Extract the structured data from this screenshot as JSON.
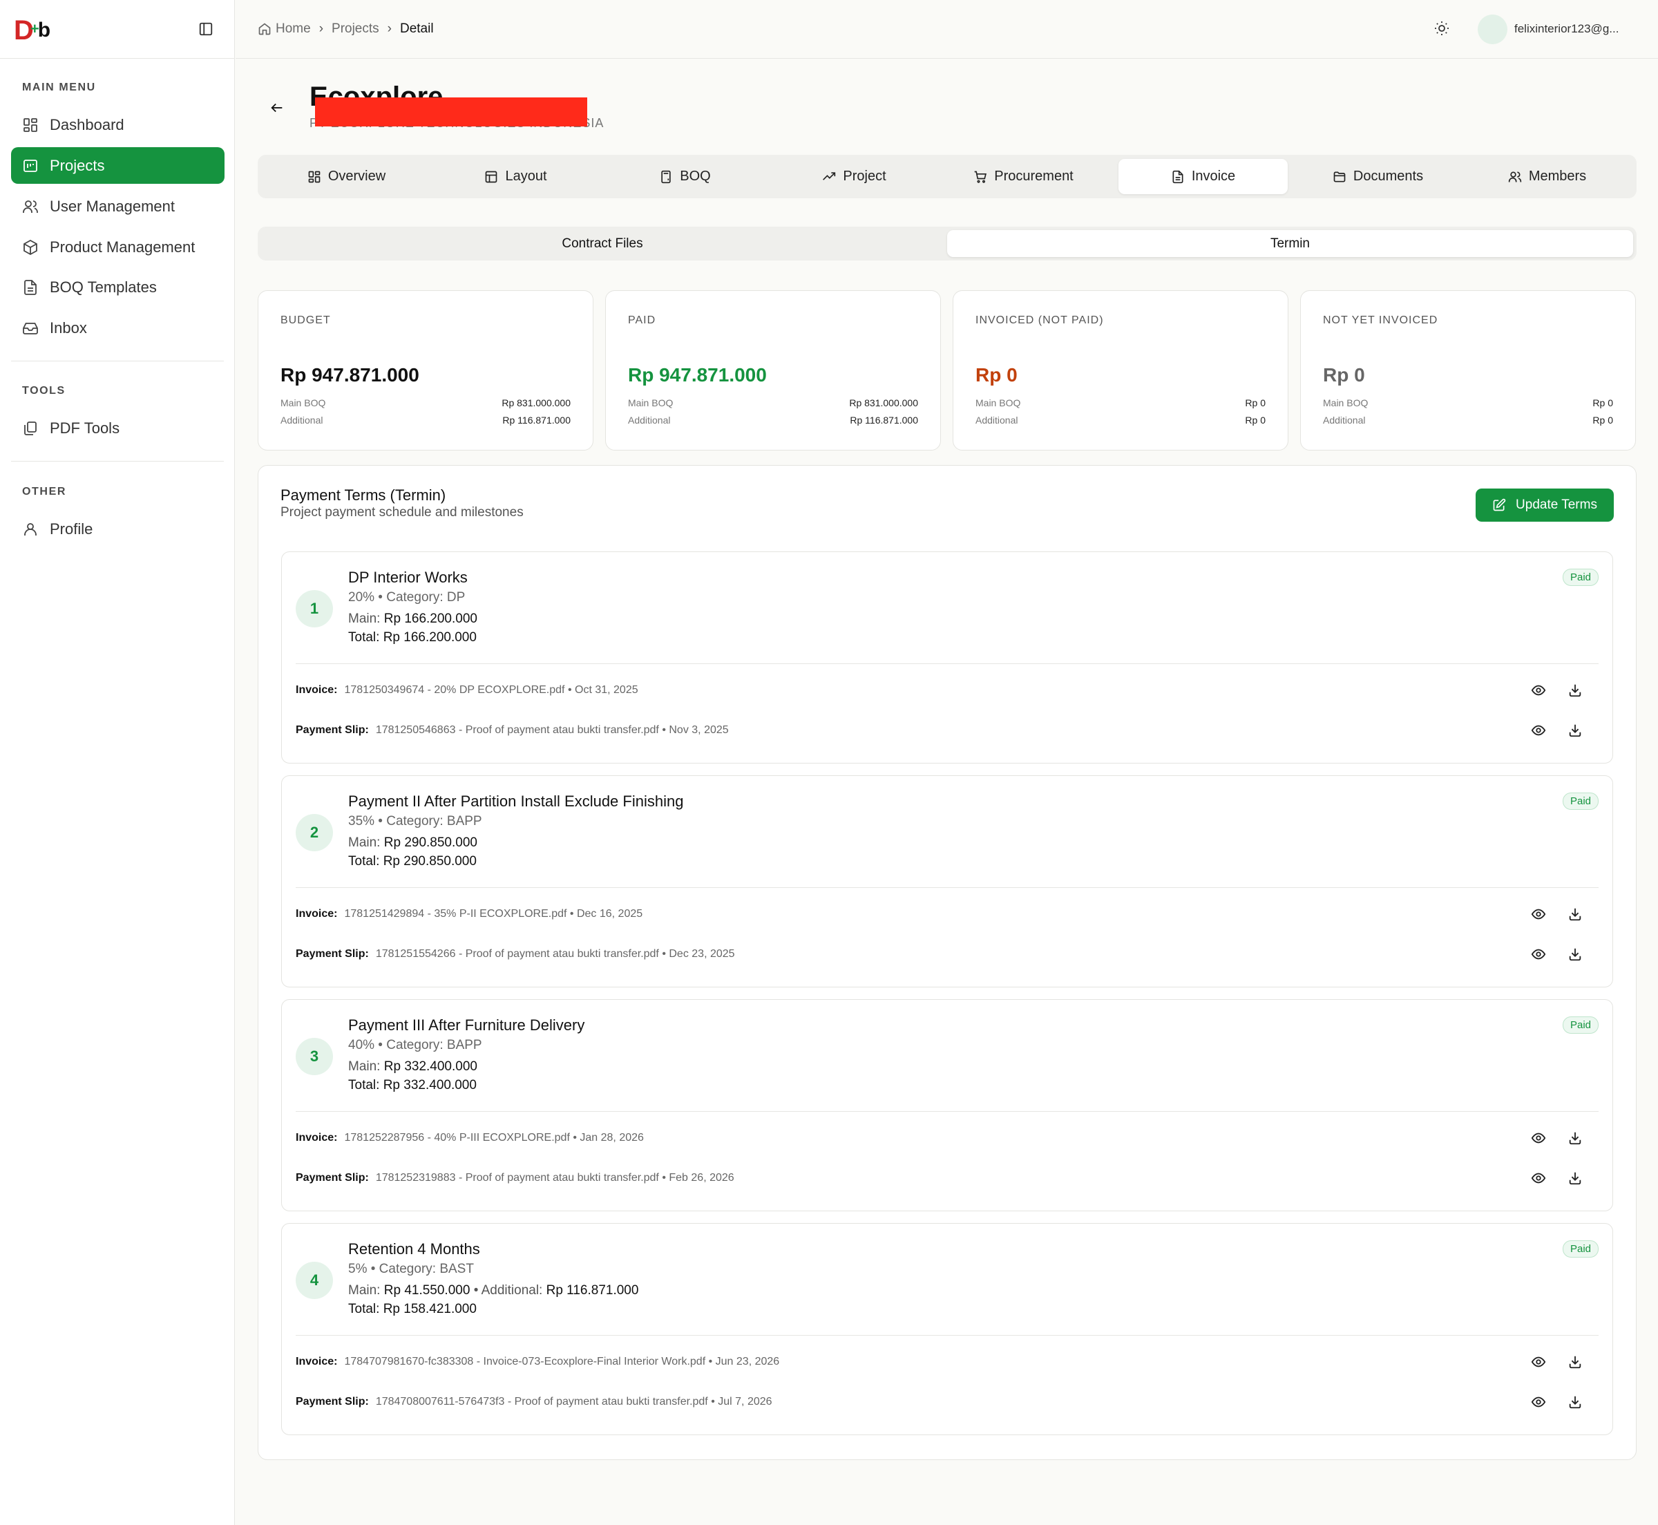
{
  "sidebar": {
    "sections": [
      {
        "label": "MAIN MENU",
        "items": [
          {
            "label": "Dashboard",
            "icon": "dashboard-icon"
          },
          {
            "label": "Projects",
            "icon": "projects-icon",
            "active": true
          },
          {
            "label": "User Management",
            "icon": "users-icon"
          },
          {
            "label": "Product Management",
            "icon": "box-icon"
          },
          {
            "label": "BOQ Templates",
            "icon": "file-icon"
          },
          {
            "label": "Inbox",
            "icon": "inbox-icon"
          }
        ]
      },
      {
        "label": "TOOLS",
        "items": [
          {
            "label": "PDF Tools",
            "icon": "copy-icon"
          }
        ]
      },
      {
        "label": "OTHER",
        "items": [
          {
            "label": "Profile",
            "icon": "user-icon"
          }
        ]
      }
    ]
  },
  "breadcrumb": {
    "home": "Home",
    "projects": "Projects",
    "current": "Detail"
  },
  "user": {
    "email": "felixinterior123@g..."
  },
  "project": {
    "name": "Ecoxplore",
    "subtitle": "PT ECOXPLORE TECHNOLOGIES INDONESIA"
  },
  "tabs": [
    {
      "label": "Overview",
      "icon": "grid-icon"
    },
    {
      "label": "Layout",
      "icon": "layout-icon"
    },
    {
      "label": "BOQ",
      "icon": "calculator-icon"
    },
    {
      "label": "Project",
      "icon": "trending-up-icon"
    },
    {
      "label": "Procurement",
      "icon": "cart-icon"
    },
    {
      "label": "Invoice",
      "icon": "document-icon",
      "active": true
    },
    {
      "label": "Documents",
      "icon": "folder-icon"
    },
    {
      "label": "Members",
      "icon": "members-icon"
    }
  ],
  "subtabs": [
    {
      "label": "Contract Files"
    },
    {
      "label": "Termin",
      "active": true
    }
  ],
  "cards": [
    {
      "label": "BUDGET",
      "amount": "Rp 947.871.000",
      "color": "#111111",
      "main_label": "Main BOQ",
      "main_value": "Rp 831.000.000",
      "add_label": "Additional",
      "add_value": "Rp 116.871.000"
    },
    {
      "label": "PAID",
      "amount": "Rp 947.871.000",
      "color": "#15933f",
      "main_label": "Main BOQ",
      "main_value": "Rp 831.000.000",
      "add_label": "Additional",
      "add_value": "Rp 116.871.000"
    },
    {
      "label": "INVOICED (NOT PAID)",
      "amount": "Rp 0",
      "color": "#c2410c",
      "main_label": "Main BOQ",
      "main_value": "Rp 0",
      "add_label": "Additional",
      "add_value": "Rp 0"
    },
    {
      "label": "NOT YET INVOICED",
      "amount": "Rp 0",
      "color": "#666666",
      "main_label": "Main BOQ",
      "main_value": "Rp 0",
      "add_label": "Additional",
      "add_value": "Rp 0"
    }
  ],
  "terms_section": {
    "title": "Payment Terms (Termin)",
    "subtitle": "Project payment schedule and milestones",
    "update_label": "Update Terms"
  },
  "labels": {
    "main": "Main:",
    "additional": "Additional:",
    "total": "Total:",
    "invoice": "Invoice:",
    "slip": "Payment Slip:"
  },
  "terms": [
    {
      "num": "1",
      "title": "DP Interior Works",
      "meta": "20% • Category: DP",
      "main": "Rp 166.200.000",
      "additional": "",
      "total": "Rp 166.200.000",
      "status": "Paid",
      "invoice_file": "1781250349674 - 20% DP ECOXPLORE.pdf",
      "invoice_date": "• Oct 31, 2025",
      "slip_file": "1781250546863 - Proof of payment atau bukti transfer.pdf",
      "slip_date": "• Nov 3, 2025"
    },
    {
      "num": "2",
      "title": "Payment II After Partition Install Exclude Finishing",
      "meta": "35% • Category: BAPP",
      "main": "Rp 290.850.000",
      "additional": "",
      "total": "Rp 290.850.000",
      "status": "Paid",
      "invoice_file": "1781251429894 - 35% P-II ECOXPLORE.pdf",
      "invoice_date": "• Dec 16, 2025",
      "slip_file": "1781251554266 - Proof of payment atau bukti transfer.pdf",
      "slip_date": "• Dec 23, 2025"
    },
    {
      "num": "3",
      "title": "Payment III After Furniture Delivery",
      "meta": "40% • Category: BAPP",
      "main": "Rp 332.400.000",
      "additional": "",
      "total": "Rp 332.400.000",
      "status": "Paid",
      "invoice_file": "1781252287956 - 40% P-III ECOXPLORE.pdf",
      "invoice_date": "• Jan 28, 2026",
      "slip_file": "1781252319883 - Proof of payment atau bukti transfer.pdf",
      "slip_date": "• Feb 26, 2026"
    },
    {
      "num": "4",
      "title": "Retention 4 Months",
      "meta": "5% • Category: BAST",
      "main": "Rp 41.550.000",
      "additional": "Rp 116.871.000",
      "total": "Rp 158.421.000",
      "status": "Paid",
      "invoice_file": "1784707981670-fc383308 - Invoice-073-Ecoxplore-Final Interior Work.pdf",
      "invoice_date": "• Jun 23, 2026",
      "slip_file": "1784708007611-576473f3 - Proof of payment atau bukti transfer.pdf",
      "slip_date": "• Jul 7, 2026"
    }
  ],
  "colors": {
    "brand_green": "#15933f",
    "logo_red": "#d32626",
    "redaction": "#ff2a1a"
  }
}
